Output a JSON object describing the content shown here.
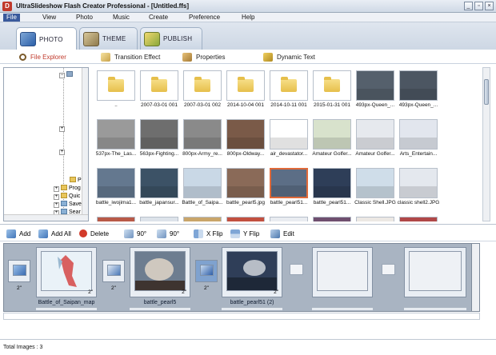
{
  "window": {
    "title": "UltraSlideshow Flash Creator Professional - [Untitled.ffs]",
    "app_icon": "D"
  },
  "menu": [
    "File",
    "View",
    "Photo",
    "Music",
    "Create",
    "Preference",
    "Help"
  ],
  "tabs": [
    {
      "label": "PHOTO",
      "icon": "photo-icon",
      "active": true
    },
    {
      "label": "THEME",
      "icon": "theme-icon",
      "active": false
    },
    {
      "label": "PUBLISH",
      "icon": "publish-icon",
      "active": false
    }
  ],
  "subtabs": [
    {
      "label": "File Explorer",
      "icon": "magnifier-icon",
      "active": true
    },
    {
      "label": "Transition Effect",
      "icon": "transition-icon",
      "active": false
    },
    {
      "label": "Properties",
      "icon": "properties-icon",
      "active": false
    },
    {
      "label": "Dynamic Text",
      "icon": "dynamic-text-icon",
      "active": false
    }
  ],
  "tree": {
    "nodes": [
      "Plac",
      "Prog",
      "Quic",
      "Save",
      "Sear"
    ]
  },
  "thumbnails": [
    {
      "caption": "..",
      "kind": "folder"
    },
    {
      "caption": "2007-03-01 001",
      "kind": "folder"
    },
    {
      "caption": "2007-03-01 002",
      "kind": "folder"
    },
    {
      "caption": "2014-10-04 001",
      "kind": "folder"
    },
    {
      "caption": "2014-10-11 001",
      "kind": "folder"
    },
    {
      "caption": "2015-01-31 001",
      "kind": "folder"
    },
    {
      "caption": "493px-Queen_...",
      "kind": "photo",
      "color": "#55606c"
    },
    {
      "caption": "493px-Queen_...",
      "kind": "photo",
      "color": "#4c5662"
    },
    {
      "caption": "537px-The_Las...",
      "kind": "photo",
      "color": "#9a9a9a"
    },
    {
      "caption": "563px-Fighting...",
      "kind": "photo",
      "color": "#6e6e6e"
    },
    {
      "caption": "800px-Army_re...",
      "kind": "photo",
      "color": "#8a8a8a"
    },
    {
      "caption": "800px-Oldway...",
      "kind": "photo",
      "color": "#7a5a48"
    },
    {
      "caption": "air_devastator...",
      "kind": "photo",
      "color": "#ffffff"
    },
    {
      "caption": "Amateur Golfer...",
      "kind": "photo",
      "color": "#d8e2cc"
    },
    {
      "caption": "Amateur Golfer...",
      "kind": "photo",
      "color": "#e6e9ee"
    },
    {
      "caption": "Arts_Entertain...",
      "kind": "photo",
      "color": "#e2e6ee"
    },
    {
      "caption": "battle_iwojima1...",
      "kind": "photo",
      "color": "#64788f"
    },
    {
      "caption": "battle_japansur...",
      "kind": "photo",
      "color": "#3c5266"
    },
    {
      "caption": "Battle_of_Saipa...",
      "kind": "photo",
      "color": "#c9d8e6"
    },
    {
      "caption": "battle_pearl5.jpg",
      "kind": "photo",
      "color": "#8a6a58"
    },
    {
      "caption": "battle_pearl51...",
      "kind": "photo",
      "color": "#5c6e86",
      "selected": true
    },
    {
      "caption": "battle_pearl51...",
      "kind": "photo",
      "color": "#2e3e58"
    },
    {
      "caption": "Classic Shell.JPG",
      "kind": "photo",
      "color": "#cfdde9"
    },
    {
      "caption": "classic shell2.JPG",
      "kind": "photo",
      "color": "#e4e8ee"
    },
    {
      "caption": "",
      "kind": "photo",
      "color": "#b85a48"
    },
    {
      "caption": "",
      "kind": "photo",
      "color": "#dde3ea"
    },
    {
      "caption": "",
      "kind": "photo",
      "color": "#c9a56a"
    },
    {
      "caption": "",
      "kind": "photo",
      "color": "#c25040"
    },
    {
      "caption": "",
      "kind": "photo",
      "color": "#e9ecf1"
    },
    {
      "caption": "",
      "kind": "photo",
      "color": "#6f4f6f"
    },
    {
      "caption": "",
      "kind": "photo",
      "color": "#ece8e4"
    },
    {
      "caption": "",
      "kind": "photo",
      "color": "#b04848"
    }
  ],
  "toolbar": [
    {
      "label": "Add",
      "icon": "add-icon"
    },
    {
      "label": "Add All",
      "icon": "add-all-icon"
    },
    {
      "label": "Delete",
      "icon": "delete-icon"
    },
    {
      "label": "90°",
      "icon": "rotate-left-icon"
    },
    {
      "label": "90°",
      "icon": "rotate-right-icon"
    },
    {
      "label": "X Flip",
      "icon": "x-flip-icon"
    },
    {
      "label": "Y Flip",
      "icon": "y-flip-icon"
    },
    {
      "label": "Edit",
      "icon": "edit-icon"
    }
  ],
  "storyboard": {
    "slides": [
      {
        "name": "Battle_of_Saipan_map",
        "duration": "2\"",
        "color": "#cfdfec"
      },
      {
        "name": "battle_pearl5",
        "duration": "2\"",
        "color": "#7a5c4c"
      },
      {
        "name": "battle_pearl51 (2)",
        "duration": "2\"",
        "color": "#4f6280"
      },
      {
        "name": "",
        "duration": "",
        "color": ""
      },
      {
        "name": "",
        "duration": "",
        "color": ""
      }
    ],
    "transitions": [
      {
        "duration": "2\""
      },
      {
        "duration": "2\""
      },
      {
        "duration": "2\""
      },
      {
        "duration": ""
      },
      {
        "duration": ""
      }
    ]
  },
  "status": {
    "text": "Total Images : 3"
  }
}
